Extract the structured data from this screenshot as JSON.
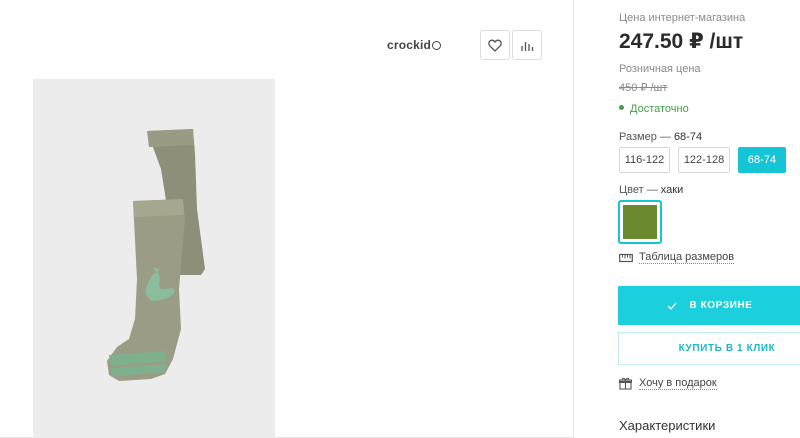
{
  "header": {
    "brand": "crockid",
    "favorite_icon": "heart-icon",
    "compare_icon": "bar-chart-icon"
  },
  "product": {
    "image_alt": "Колготки хаки с динозавром"
  },
  "pricing": {
    "online_price_label": "Цена интернет-магазина",
    "online_price": "247.50 ₽ /шт",
    "retail_price_label": "Розничная цена",
    "retail_price": "450 ₽ /шт",
    "stock_status": "Достаточно",
    "stock_color": "#43a047"
  },
  "size": {
    "label": "Размер",
    "separator": "—",
    "selected": "68-74",
    "options": [
      "116-122",
      "122-128",
      "68-74"
    ]
  },
  "color": {
    "label": "Цвет",
    "separator": "—",
    "selected": "хаки",
    "swatch_hex": "#6b8a2f"
  },
  "size_table": {
    "label": "Таблица размеров",
    "icon": "ruler-icon"
  },
  "actions": {
    "cart_label": "В КОРЗИНЕ",
    "cart_icon": "check-icon",
    "one_click_label": "КУПИТЬ В 1 КЛИК",
    "gift_label": "Хочу в подарок",
    "gift_icon": "gift-icon",
    "accent_color": "#1ccfdc"
  },
  "specs": {
    "heading": "Характеристики"
  }
}
